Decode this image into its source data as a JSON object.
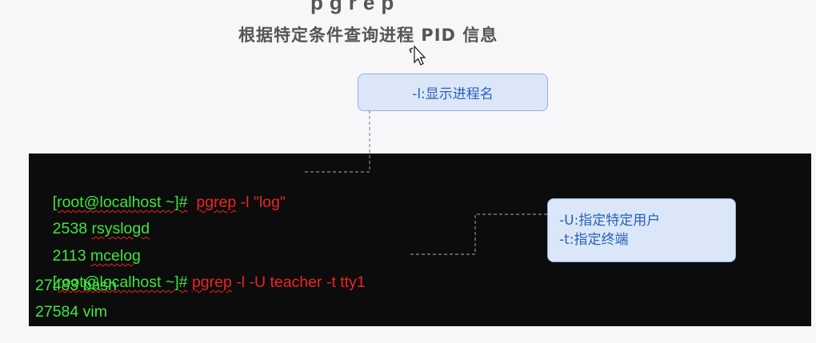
{
  "slide": {
    "top_fragment": "pgrep",
    "title": "根据特定条件查询进程 PID 信息"
  },
  "callouts": {
    "l_option": "-l:显示进程名",
    "u_option": "-U:指定特定用户",
    "t_option": "-t:指定终端"
  },
  "terminal": {
    "line1": {
      "prompt": "[root@localhost ~]#",
      "cmd": "pgrep",
      "args": " -l \"log\""
    },
    "line2": {
      "pid": "2538",
      "name": "rsyslogd"
    },
    "line3": {
      "pid": "2113",
      "name": "mcelog"
    },
    "line4": {
      "prompt": "[root@localhost ~]#",
      "cmd": "pgrep",
      "args": " -l -U teacher -t tty1"
    },
    "line5": {
      "text": "27483 bash"
    },
    "line6": {
      "text": "27584 vim"
    }
  },
  "colors": {
    "prompt": "#3ee63e",
    "command": "#ee2424",
    "callout_bg": "#dbe7f8",
    "callout_text": "#2a60b8",
    "terminal_bg": "#0c0c0c"
  }
}
